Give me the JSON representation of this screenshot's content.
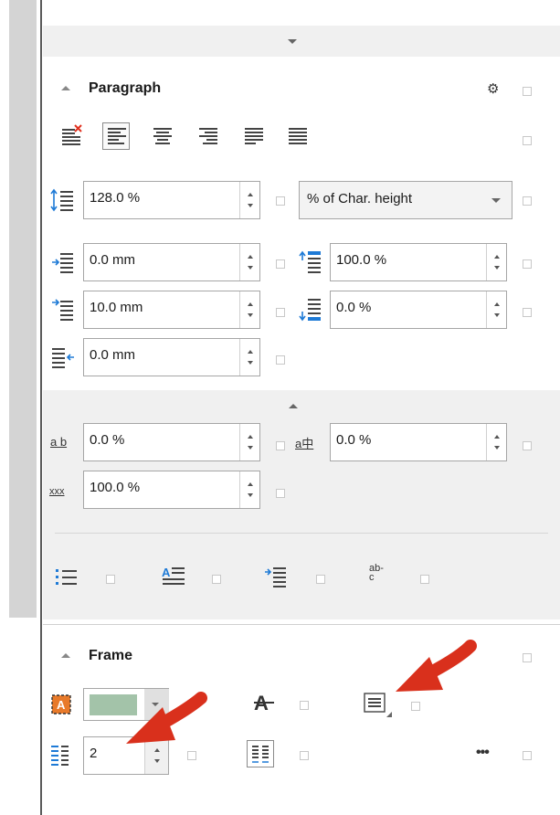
{
  "paragraph": {
    "title": "Paragraph",
    "line_spacing": {
      "value": "128.0 %",
      "unit_select": "% of Char. height"
    },
    "indent_before": "0.0 mm",
    "spacing_above_pct": "100.0 %",
    "first_line_indent": "10.0 mm",
    "spacing_below_pct": "0.0 %",
    "indent_after": "0.0 mm",
    "char_spacing": "0.0 %",
    "char_spacing_asian": "0.0 %",
    "char_scale": "100.0 %",
    "icons": {
      "char_spacing_glyph": "a b",
      "char_spacing_asian_glyph": "a中",
      "char_scale_glyph": "xxx",
      "hyphenation_glyph_top": "ab-",
      "hyphenation_glyph_bottom": "c"
    }
  },
  "frame": {
    "title": "Frame",
    "columns_value": "2",
    "more_label": "•••",
    "fill_color": "#a3c3a9"
  },
  "colors": {
    "accent_blue": "#1e7ad6",
    "arrow_red": "#d9301c",
    "panel_gray": "#f0f0f0"
  }
}
